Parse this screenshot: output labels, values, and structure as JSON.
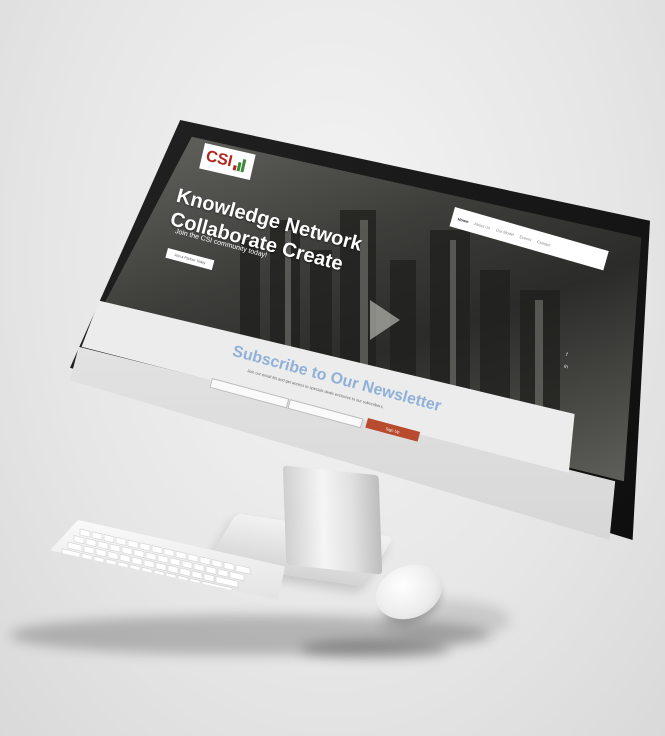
{
  "logo": {
    "text": "CSI"
  },
  "nav": {
    "items": [
      "Home",
      "About Us",
      "Our Model",
      "Events",
      "Contact"
    ]
  },
  "hero": {
    "title_line1": "Knowledge Network",
    "title_line2": "Collaborate Create",
    "subtitle": "Join the CSI community today!",
    "button": "Join a Partner Today"
  },
  "newsletter": {
    "title": "Subscribe to Our Newsletter",
    "subtitle": "Join our email list and get access to specials deals exclusive to our subscribers.",
    "button": "Sign Up"
  },
  "social": {
    "icon1": "f",
    "icon2": "in"
  }
}
